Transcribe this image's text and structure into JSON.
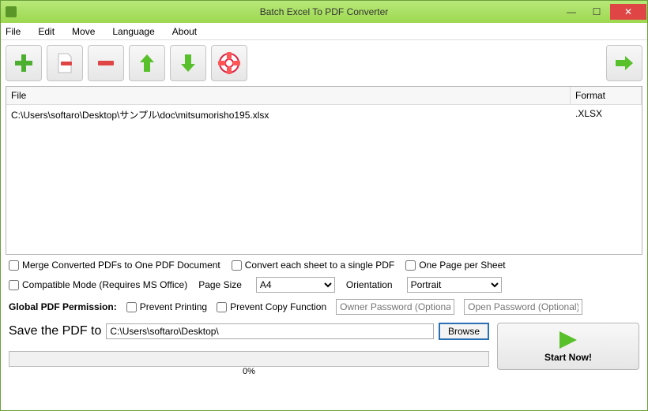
{
  "window": {
    "title": "Batch Excel To PDF Converter"
  },
  "menu": {
    "file": "File",
    "edit": "Edit",
    "move": "Move",
    "language": "Language",
    "about": "About"
  },
  "table": {
    "headers": {
      "file": "File",
      "format": "Format"
    },
    "rows": [
      {
        "file": "C:\\Users\\softaro\\Desktop\\サンプル\\doc\\mitsumorisho195.xlsx",
        "format": ".XLSX"
      }
    ]
  },
  "options": {
    "merge": "Merge Converted PDFs to One PDF Document",
    "convertSheet": "Convert each sheet to a single PDF",
    "onePage": "One Page per Sheet",
    "compatible": "Compatible Mode (Requires MS Office)",
    "pageSizeLabel": "Page Size",
    "pageSizeValue": "A4",
    "orientationLabel": "Orientation",
    "orientationValue": "Portrait"
  },
  "permissions": {
    "label": "Global PDF Permission:",
    "preventPrint": "Prevent Printing",
    "preventCopy": "Prevent Copy Function",
    "ownerPwdPlaceholder": "Owner Password (Optional)",
    "openPwdPlaceholder": "Open Password (Optional)"
  },
  "save": {
    "label": "Save the PDF to",
    "path": "C:\\Users\\softaro\\Desktop\\",
    "browse": "Browse"
  },
  "progress": {
    "text": "0%"
  },
  "start": {
    "label": "Start Now!"
  }
}
